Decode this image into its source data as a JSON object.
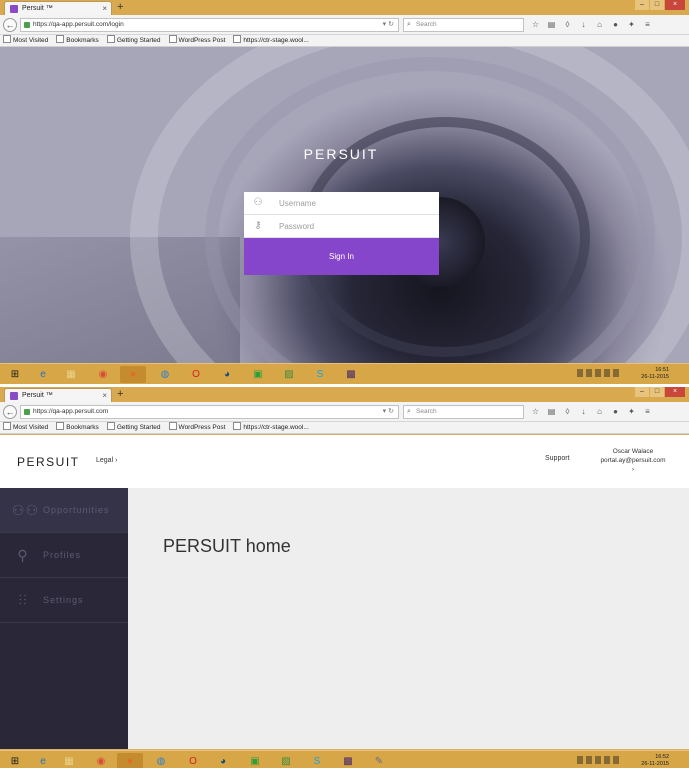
{
  "top": {
    "tab_title": "Persuit ™",
    "url": "https://qa-app.persuit.com/login",
    "search_placeholder": "Search",
    "bookmarks": [
      "Most Visited",
      "Bookmarks",
      "Getting Started",
      "WordPress Post",
      "https://ctr-stage.wool..."
    ],
    "brand": "PERSUIT",
    "username_placeholder": "Username",
    "password_placeholder": "Password",
    "signin_label": "Sign In",
    "clock_time": "16:51",
    "clock_date": "26-11-2015"
  },
  "bottom": {
    "tab_title": "Persuit ™",
    "url": "https://qa-app.persuit.com",
    "search_value": "Search",
    "bookmarks": [
      "Most Visited",
      "Bookmarks",
      "Getting Started",
      "WordPress Post",
      "https://ctr-stage.wool..."
    ],
    "brand": "PERSUIT",
    "legal_label": "Legal",
    "support_label": "Support",
    "user_name": "Oscar Walace",
    "user_email": "portal.ay@persuit.com",
    "sidebar": [
      "Opportunities",
      "Profiles",
      "Settings"
    ],
    "page_title": "PERSUIT home",
    "clock_time": "16:52",
    "clock_date": "26-11-2015"
  },
  "colors": {
    "accent": "#8646cc",
    "sidebar_bg": "#2a2838",
    "taskbar": "#d6a647"
  }
}
